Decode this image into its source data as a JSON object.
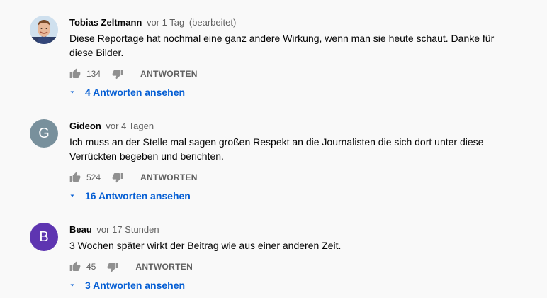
{
  "comments": [
    {
      "author": "Tobias Zeltmann",
      "time": "vor 1 Tag",
      "edited": "(bearbeitet)",
      "text": "Diese Reportage hat nochmal eine ganz andere Wirkung, wenn man sie heute schaut. Danke für diese Bilder.",
      "likes": "134",
      "reply_label": "ANTWORTEN",
      "replies_label": "4 Antworten ansehen"
    },
    {
      "author": "Gideon",
      "time": "vor 4 Tagen",
      "avatar_letter": "G",
      "avatar_color": "#78909c",
      "text": "Ich muss an der Stelle mal sagen großen Respekt an die Journalisten die sich dort unter diese Verrückten begeben und berichten.",
      "likes": "524",
      "reply_label": "ANTWORTEN",
      "replies_label": "16 Antworten ansehen"
    },
    {
      "author": "Beau",
      "time": "vor 17 Stunden",
      "avatar_letter": "B",
      "avatar_color": "#5e35b1",
      "text": "3 Wochen später wirkt der Beitrag wie aus einer anderen Zeit.",
      "likes": "45",
      "reply_label": "ANTWORTEN",
      "replies_label": "3 Antworten ansehen"
    }
  ],
  "icons": {
    "like": "thumb-up-icon",
    "dislike": "thumb-down-icon",
    "expand": "chevron-down-icon"
  },
  "colors": {
    "link": "#065fd4",
    "secondary_text": "#606060",
    "icon": "#909090"
  }
}
